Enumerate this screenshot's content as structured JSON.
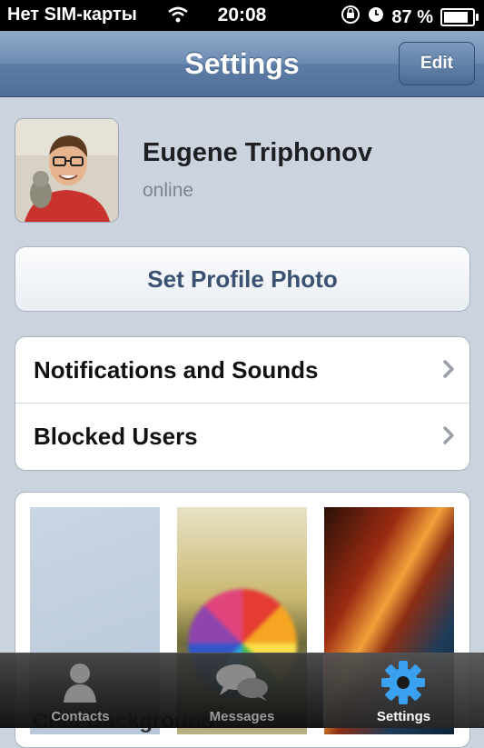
{
  "status_bar": {
    "carrier": "Нет SIM-карты",
    "time": "20:08",
    "battery": "87 %",
    "battery_level": 0.87
  },
  "navbar": {
    "title": "Settings",
    "edit_label": "Edit"
  },
  "profile": {
    "name": "Eugene Triphonov",
    "status": "online"
  },
  "set_photo_label": "Set Profile Photo",
  "menu": {
    "items": [
      {
        "label": "Notifications and Sounds"
      },
      {
        "label": "Blocked Users"
      }
    ]
  },
  "wallpapers": {
    "peek_label": "Chat Background"
  },
  "tabbar": {
    "tabs": [
      {
        "label": "Contacts",
        "icon": "person-icon"
      },
      {
        "label": "Messages",
        "icon": "chat-bubbles-icon"
      },
      {
        "label": "Settings",
        "icon": "gear-icon"
      }
    ],
    "active_tab": "Settings",
    "accent": "#3aa0f0"
  }
}
